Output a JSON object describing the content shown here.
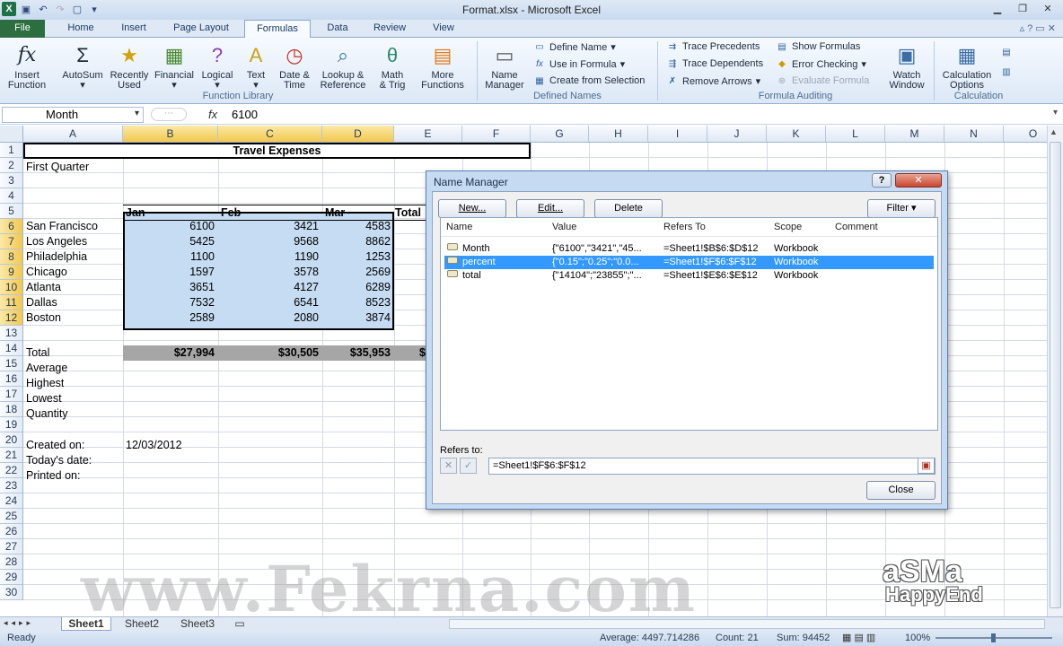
{
  "window": {
    "title": "Format.xlsx - Microsoft Excel",
    "logo": "X"
  },
  "tabs": [
    "File",
    "Home",
    "Insert",
    "Page Layout",
    "Formulas",
    "Data",
    "Review",
    "View"
  ],
  "ribbon": {
    "function_library": {
      "insert_function": [
        "Insert",
        "Function"
      ],
      "autosum": "AutoSum",
      "recently_used": [
        "Recently",
        "Used"
      ],
      "financial": "Financial",
      "logical": "Logical",
      "text": "Text",
      "date_time": [
        "Date &",
        "Time"
      ],
      "lookup": [
        "Lookup &",
        "Reference"
      ],
      "math": [
        "Math",
        "& Trig"
      ],
      "more": [
        "More",
        "Functions"
      ],
      "label": "Function Library"
    },
    "defined_names": {
      "name_manager": [
        "Name",
        "Manager"
      ],
      "define_name": "Define Name",
      "use_in_formula": "Use in Formula",
      "create_from_selection": "Create from Selection",
      "label": "Defined Names"
    },
    "formula_auditing": {
      "trace_precedents": "Trace Precedents",
      "trace_dependents": "Trace Dependents",
      "remove_arrows": "Remove Arrows",
      "show_formulas": "Show Formulas",
      "error_checking": "Error Checking",
      "evaluate_formula": "Evaluate Formula",
      "watch_window": [
        "Watch",
        "Window"
      ],
      "label": "Formula Auditing"
    },
    "calculation": {
      "options": [
        "Calculation",
        "Options"
      ],
      "label": "Calculation"
    }
  },
  "formula_bar": {
    "name_box": "Month",
    "fx": "fx",
    "value": "6100"
  },
  "columns": [
    "A",
    "B",
    "C",
    "D",
    "E",
    "F",
    "G",
    "H",
    "I",
    "J",
    "K",
    "L",
    "M",
    "N",
    "O"
  ],
  "rows": [
    "1",
    "2",
    "3",
    "4",
    "5",
    "6",
    "7",
    "8",
    "9",
    "10",
    "11",
    "12",
    "13",
    "14",
    "15",
    "16",
    "17",
    "18",
    "19",
    "20",
    "21",
    "22",
    "23",
    "24",
    "25",
    "26",
    "27",
    "28",
    "29",
    "30"
  ],
  "sheet": {
    "title": "Travel Expenses",
    "first_quarter": "First Quarter",
    "headers": [
      "Jan",
      "Feb",
      "Mar",
      "Total"
    ],
    "cities": [
      {
        "name": "San Francisco",
        "jan": "6100",
        "feb": "3421",
        "mar": "4583"
      },
      {
        "name": "Los Angeles",
        "jan": "5425",
        "feb": "9568",
        "mar": "8862"
      },
      {
        "name": "Philadelphia",
        "jan": "1100",
        "feb": "1190",
        "mar": "1253"
      },
      {
        "name": "Chicago",
        "jan": "1597",
        "feb": "3578",
        "mar": "2569"
      },
      {
        "name": "Atlanta",
        "jan": "3651",
        "feb": "4127",
        "mar": "6289"
      },
      {
        "name": "Dallas",
        "jan": "7532",
        "feb": "6541",
        "mar": "8523"
      },
      {
        "name": "Boston",
        "jan": "2589",
        "feb": "2080",
        "mar": "3874"
      }
    ],
    "total_label": "Total",
    "totals": [
      "$27,994",
      "$30,505",
      "$35,953",
      "$"
    ],
    "stats": [
      "Average",
      "Highest",
      "Lowest",
      "Quantity"
    ],
    "created_on": "Created on:",
    "created_date": "12/03/2012",
    "todays_date": "Today's date:",
    "printed_on": "Printed on:"
  },
  "dialog": {
    "title": "Name Manager",
    "buttons": {
      "new": "New...",
      "edit": "Edit...",
      "delete": "Delete",
      "filter": "Filter",
      "close": "Close"
    },
    "columns": [
      "Name",
      "Value",
      "Refers To",
      "Scope",
      "Comment"
    ],
    "names": [
      {
        "name": "Month",
        "value": "{\"6100\",\"3421\",\"45...",
        "refers": "=Sheet1!$B$6:$D$12",
        "scope": "Workbook",
        "comment": ""
      },
      {
        "name": "percent",
        "value": "{\"0.15\";\"0.25\";\"0.0...",
        "refers": "=Sheet1!$F$6:$F$12",
        "scope": "Workbook",
        "comment": ""
      },
      {
        "name": "total",
        "value": "{\"14104\";\"23855\";\"...",
        "refers": "=Sheet1!$E$6:$E$12",
        "scope": "Workbook",
        "comment": ""
      }
    ],
    "refers_to_label": "Refers to:",
    "refers_to_value": "=Sheet1!$F$6:$F$12",
    "help": "?",
    "close_x": "✕"
  },
  "sheet_tabs": [
    "Sheet1",
    "Sheet2",
    "Sheet3"
  ],
  "status": {
    "ready": "Ready",
    "average": "Average: 4497.714286",
    "count": "Count: 21",
    "sum": "Sum: 94452",
    "zoom": "100%"
  },
  "watermark": {
    "site": "www.Fekrna.com",
    "brand1": "aSMa",
    "brand2": "HappyEnd"
  }
}
